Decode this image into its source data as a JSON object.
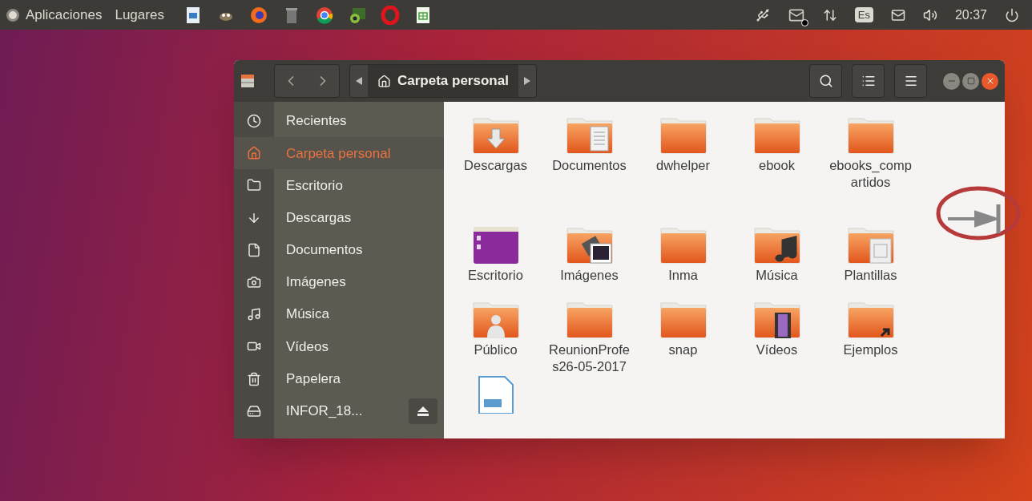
{
  "top_panel": {
    "menus": [
      "Aplicaciones",
      "Lugares"
    ],
    "launchers": [
      {
        "kind": "image-file"
      },
      {
        "kind": "creature"
      },
      {
        "kind": "fox-globe"
      },
      {
        "kind": "trash"
      },
      {
        "kind": "tricolor"
      },
      {
        "kind": "camera"
      },
      {
        "kind": "ring"
      },
      {
        "kind": "spreadsheet"
      }
    ],
    "indicators": [
      {
        "kind": "usb"
      },
      {
        "kind": "mail-badge"
      },
      {
        "kind": "network"
      },
      {
        "kind": "keyboard",
        "text": "Es"
      },
      {
        "kind": "mail"
      },
      {
        "kind": "volume"
      },
      {
        "kind": "clock",
        "text": "20:37"
      },
      {
        "kind": "power"
      }
    ]
  },
  "window": {
    "path": "Carpeta personal",
    "sidebar": [
      {
        "kind": "recent",
        "label": "Recientes",
        "selected": false
      },
      {
        "kind": "home",
        "label": "Carpeta personal",
        "selected": true
      },
      {
        "kind": "desktop",
        "label": "Escritorio",
        "selected": false
      },
      {
        "kind": "download",
        "label": "Descargas",
        "selected": false
      },
      {
        "kind": "document",
        "label": "Documentos",
        "selected": false
      },
      {
        "kind": "camera",
        "label": "Imágenes",
        "selected": false
      },
      {
        "kind": "music",
        "label": "Música",
        "selected": false
      },
      {
        "kind": "video",
        "label": "Vídeos",
        "selected": false
      },
      {
        "kind": "trash",
        "label": "Papelera",
        "selected": false
      },
      {
        "kind": "drive",
        "label": "INFOR_18...",
        "selected": false
      }
    ],
    "files": [
      {
        "kind": "download",
        "name": "Descargas"
      },
      {
        "kind": "documents",
        "name": "Documentos"
      },
      {
        "kind": "folder",
        "name": "dwhelper"
      },
      {
        "kind": "folder",
        "name": "ebook"
      },
      {
        "kind": "folder",
        "name": "ebooks_compartidos"
      },
      {
        "kind": "desktop",
        "name": "Escritorio"
      },
      {
        "kind": "pictures",
        "name": "Imágenes"
      },
      {
        "kind": "folder",
        "name": "Inma"
      },
      {
        "kind": "music",
        "name": "Música"
      },
      {
        "kind": "templates",
        "name": "Plantillas"
      },
      {
        "kind": "public",
        "name": "Público"
      },
      {
        "kind": "folder",
        "name": "ReunionProfes26-05-2017"
      },
      {
        "kind": "folder",
        "name": "snap"
      },
      {
        "kind": "videos",
        "name": "Vídeos"
      },
      {
        "kind": "examples",
        "name": "Ejemplos"
      },
      {
        "kind": "office-doc"
      }
    ]
  }
}
